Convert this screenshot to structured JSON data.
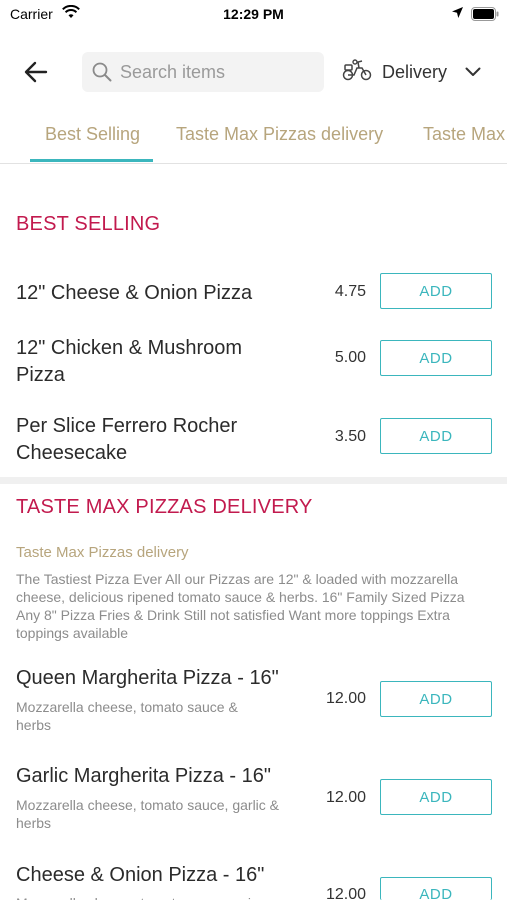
{
  "status_bar": {
    "carrier": "Carrier",
    "time": "12:29 PM",
    "wifi_icon": "wifi-icon",
    "location_icon": "location-arrow-icon",
    "battery_icon": "battery-icon"
  },
  "header": {
    "back_icon": "arrow-left-icon",
    "search_placeholder": "Search items",
    "search_value": "",
    "mode_label": "Delivery",
    "mode_icon": "scooter-icon"
  },
  "tabs": [
    {
      "label": "Best Selling",
      "active": true
    },
    {
      "label": "Taste Max Pizzas delivery",
      "active": false
    },
    {
      "label": "Taste Max",
      "active": false
    }
  ],
  "sections": {
    "best_selling": {
      "title": "BEST SELLING",
      "items": [
        {
          "name": "12\" Cheese & Onion Pizza",
          "price": "4.75",
          "button": "ADD"
        },
        {
          "name": "12\" Chicken & Mushroom Pizza",
          "price": "5.00",
          "button": "ADD"
        },
        {
          "name": "Per Slice Ferrero Rocher Cheesecake",
          "price": "3.50",
          "button": "ADD"
        }
      ]
    },
    "taste_max": {
      "title": "TASTE MAX PIZZAS DELIVERY",
      "subtitle": "Taste Max Pizzas delivery",
      "description": "The Tastiest Pizza Ever   All our Pizzas are 12\" & loaded with mozzarella cheese, delicious ripened tomato sauce & herbs.   16\" Family Sized Pizza  Any 8\" Pizza Fries & Drink   Still not satisfied Want more toppings  Extra toppings available",
      "items": [
        {
          "name": "Queen Margherita Pizza - 16\"",
          "desc": "Mozzarella cheese, tomato sauce & herbs",
          "price": "12.00",
          "button": "ADD"
        },
        {
          "name": "Garlic Margherita Pizza - 16\"",
          "desc": "Mozzarella cheese, tomato sauce, garlic & herbs",
          "price": "12.00",
          "button": "ADD"
        },
        {
          "name": "Cheese & Onion Pizza - 16\"",
          "desc": "Mozzarella cheese, tomato sauce, onion",
          "price": "12.00",
          "button": "ADD"
        }
      ]
    }
  },
  "colors": {
    "accent_teal": "#3bb6bd",
    "section_red": "#c21a4e",
    "tab_gold": "#b7a57d"
  }
}
